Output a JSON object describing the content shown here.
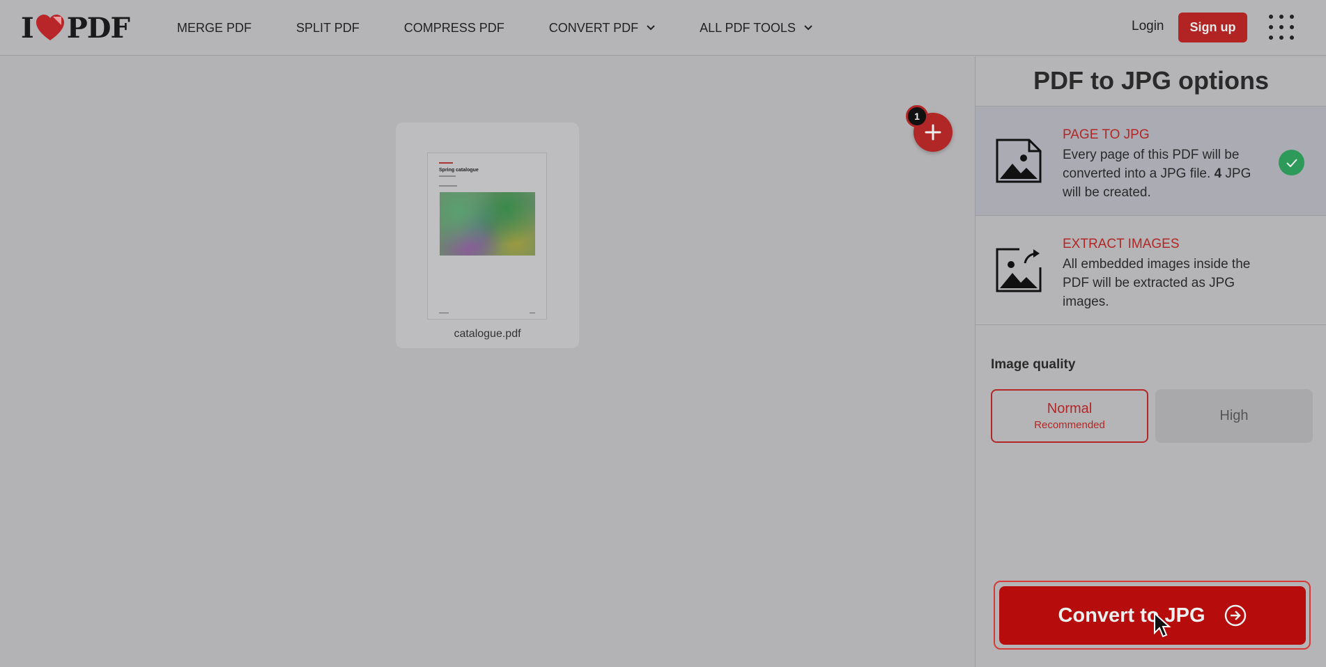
{
  "header": {
    "logo_text_left": "I",
    "logo_text_right": "PDF",
    "nav": [
      {
        "label": "MERGE PDF",
        "dropdown": false
      },
      {
        "label": "SPLIT PDF",
        "dropdown": false
      },
      {
        "label": "COMPRESS PDF",
        "dropdown": false
      },
      {
        "label": "CONVERT PDF",
        "dropdown": true
      },
      {
        "label": "ALL PDF TOOLS",
        "dropdown": true
      }
    ],
    "login_label": "Login",
    "signup_label": "Sign up",
    "apps_icon": "grid-icon"
  },
  "main": {
    "file": {
      "name": "catalogue.pdf",
      "thumb_title": "Spring catalogue"
    },
    "file_count_badge": "1"
  },
  "sidebar": {
    "title": "PDF to JPG options",
    "options": [
      {
        "title": "PAGE TO JPG",
        "desc_before": "Every page of this PDF will be converted into a JPG file. ",
        "desc_count": "4",
        "desc_after": " JPG will be created.",
        "selected": true
      },
      {
        "title": "EXTRACT IMAGES",
        "desc": "All embedded images inside the PDF will be extracted as JPG images.",
        "selected": false
      }
    ],
    "image_quality_label": "Image quality",
    "quality": {
      "normal_label": "Normal",
      "normal_sub": "Recommended",
      "high_label": "High",
      "selected": "Normal"
    },
    "convert_label": "Convert to JPG"
  },
  "colors": {
    "brand_red": "#b12727",
    "convert_red": "#b60c0c",
    "check_green": "#2e9a5a"
  }
}
